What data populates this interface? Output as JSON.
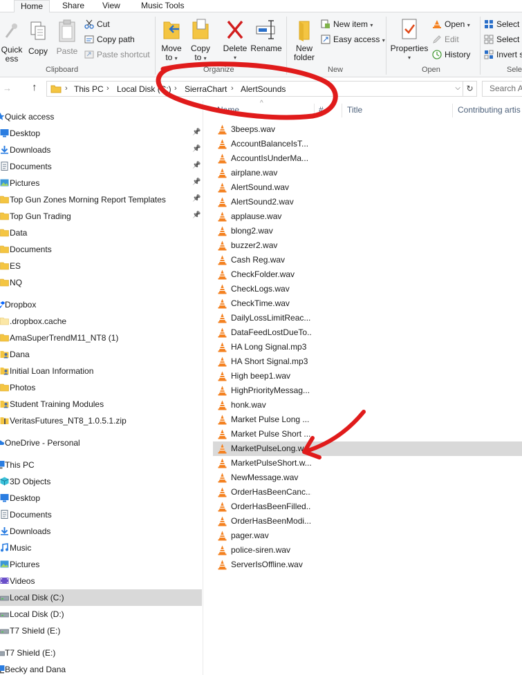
{
  "tabs": [
    {
      "label": "Home",
      "active": true
    },
    {
      "label": "Share",
      "active": false
    },
    {
      "label": "View",
      "active": false
    },
    {
      "label": "Music Tools",
      "active": false
    }
  ],
  "ribbon": {
    "quick_access_label": "Quick",
    "quick_access_label2": "ess",
    "copy": "Copy",
    "paste": "Paste",
    "cut": "Cut",
    "copy_path": "Copy path",
    "paste_shortcut": "Paste shortcut",
    "clipboard_group": "Clipboard",
    "move_to": "Move",
    "move_to2": "to",
    "copy_to": "Copy",
    "copy_to2": "to",
    "delete": "Delete",
    "rename": "Rename",
    "organize_group": "Organize",
    "new_folder": "New",
    "new_folder2": "folder",
    "new_item": "New item",
    "easy_access": "Easy access",
    "new_group": "New",
    "properties": "Properties",
    "open": "Open",
    "edit": "Edit",
    "history": "History",
    "open_group": "Open",
    "select_all": "Select a",
    "select_none": "Select n",
    "invert_selection": "Invert s",
    "select_group": "Sele"
  },
  "address": {
    "crumbs": [
      "This PC",
      "Local Disk (C:)",
      "SierraChart",
      "AlertSounds"
    ],
    "search_placeholder": "Search A"
  },
  "columns": {
    "name": "Name",
    "number": "#",
    "title": "Title",
    "contributing_artists": "Contributing artis"
  },
  "nav": [
    {
      "label": "Quick access",
      "icon": "star",
      "pinned": false
    },
    {
      "label": "Desktop",
      "icon": "desktop",
      "pinned": true
    },
    {
      "label": "Downloads",
      "icon": "download",
      "pinned": true
    },
    {
      "label": "Documents",
      "icon": "document",
      "pinned": true
    },
    {
      "label": "Pictures",
      "icon": "picture",
      "pinned": true
    },
    {
      "label": "Top Gun Zones Morning Report Templates",
      "icon": "folder",
      "pinned": true
    },
    {
      "label": "Top Gun Trading",
      "icon": "folder",
      "pinned": true
    },
    {
      "label": "Data",
      "icon": "folder",
      "pinned": false
    },
    {
      "label": "Documents",
      "icon": "folder",
      "pinned": false
    },
    {
      "label": "ES",
      "icon": "folder",
      "pinned": false
    },
    {
      "label": "NQ",
      "icon": "folder",
      "pinned": false
    },
    {
      "label": "Dropbox",
      "icon": "dropbox",
      "pinned": false
    },
    {
      "label": ".dropbox.cache",
      "icon": "folder-light",
      "pinned": false
    },
    {
      "label": "AmaSuperTrendM11_NT8 (1)",
      "icon": "folder",
      "pinned": false
    },
    {
      "label": "Dana",
      "icon": "user",
      "pinned": false
    },
    {
      "label": "Initial Loan Information",
      "icon": "user",
      "pinned": false
    },
    {
      "label": "Photos",
      "icon": "folder",
      "pinned": false
    },
    {
      "label": "Student Training Modules",
      "icon": "user",
      "pinned": false
    },
    {
      "label": "VeritasFutures_NT8_1.0.5.1.zip",
      "icon": "zip",
      "pinned": false
    },
    {
      "label": "OneDrive - Personal",
      "icon": "cloud",
      "pinned": false
    },
    {
      "label": "This PC",
      "icon": "pc",
      "pinned": false
    },
    {
      "label": "3D Objects",
      "icon": "cube",
      "pinned": false
    },
    {
      "label": "Desktop",
      "icon": "desktop",
      "pinned": false
    },
    {
      "label": "Documents",
      "icon": "document",
      "pinned": false
    },
    {
      "label": "Downloads",
      "icon": "download",
      "pinned": false
    },
    {
      "label": "Music",
      "icon": "music",
      "pinned": false
    },
    {
      "label": "Pictures",
      "icon": "picture",
      "pinned": false
    },
    {
      "label": "Videos",
      "icon": "video",
      "pinned": false
    },
    {
      "label": "Local Disk (C:)",
      "icon": "drive",
      "pinned": false,
      "selected": true
    },
    {
      "label": "Local Disk (D:)",
      "icon": "drive",
      "pinned": false
    },
    {
      "label": "T7 Shield (E:)",
      "icon": "drive",
      "pinned": false
    },
    {
      "label": "T7 Shield (E:)",
      "icon": "drive",
      "pinned": false
    },
    {
      "label": "Becky and Dana",
      "icon": "network",
      "pinned": false
    }
  ],
  "files": [
    "3beeps.wav",
    "AccountBalanceIsT...",
    "AccountIsUnderMa...",
    "airplane.wav",
    "AlertSound.wav",
    "AlertSound2.wav",
    "applause.wav",
    "blong2.wav",
    "buzzer2.wav",
    "Cash Reg.wav",
    "CheckFolder.wav",
    "CheckLogs.wav",
    "CheckTime.wav",
    "DailyLossLimitReac...",
    "DataFeedLostDueTo...",
    "HA Long Signal.mp3",
    "HA Short Signal.mp3",
    "High beep1.wav",
    "HighPriorityMessag...",
    "honk.wav",
    "Market Pulse Long ...",
    "Market Pulse Short ...",
    "MarketPulseLong.wav",
    "MarketPulseShort.w...",
    "NewMessage.wav",
    "OrderHasBeenCanc...",
    "OrderHasBeenFilled...",
    "OrderHasBeenModi...",
    "pager.wav",
    "police-siren.wav",
    "ServerIsOffline.wav"
  ],
  "selected_file_index": 22,
  "colors": {
    "annotation_red": "#e01b1b",
    "folder_yellow": "#f4c542",
    "vlc_orange": "#f48120",
    "selection_gray": "#d9d9d9"
  }
}
